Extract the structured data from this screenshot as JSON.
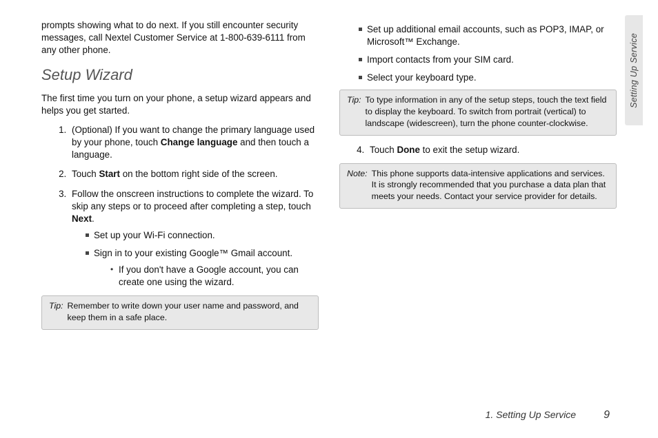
{
  "sideTab": "Setting Up Service",
  "footer": {
    "chapter": "1. Setting Up Service",
    "page": "9"
  },
  "col1": {
    "intro": "prompts showing what to do next. If you still encounter security messages, call Nextel Customer Service at 1-800-639-6111 from any other phone.",
    "heading": "Setup Wizard",
    "lead": "The first time you turn on your phone, a setup wizard appears and helps you get started.",
    "step1_a": "(Optional) If you want to change the primary language used by your phone, touch ",
    "step1_bold": "Change language",
    "step1_b": " and then touch a language.",
    "step2_a": "Touch ",
    "step2_bold": "Start",
    "step2_b": " on the bottom right side of the screen.",
    "step3_a": "Follow the onscreen instructions to complete the wizard. To skip any steps or to proceed after completing a step, touch ",
    "step3_bold": "Next",
    "step3_b": ".",
    "sq1": "Set up your Wi-Fi connection.",
    "sq2": "Sign in to your existing Google™ Gmail account.",
    "dot1": "If you don't have a Google account, you can create one using the wizard.",
    "tip1_label": "Tip:",
    "tip1_body": "Remember to write down your user name and password, and keep them in a safe place."
  },
  "col2": {
    "sq3": "Set up additional email accounts, such as POP3, IMAP, or Microsoft™ Exchange.",
    "sq4": "Import contacts from your SIM card.",
    "sq5": "Select your keyboard type.",
    "tip2_label": "Tip:",
    "tip2_body": "To type information in any of the setup steps, touch the text field to display the keyboard. To switch from portrait (vertical) to landscape (widescreen), turn the phone counter-clockwise.",
    "step4_a": "Touch ",
    "step4_bold": "Done",
    "step4_b": " to exit the setup wizard.",
    "note_label": "Note:",
    "note_body": "This phone supports data-intensive applications and services. It is strongly recommended that you purchase a data plan that meets your needs. Contact your service provider for details."
  }
}
